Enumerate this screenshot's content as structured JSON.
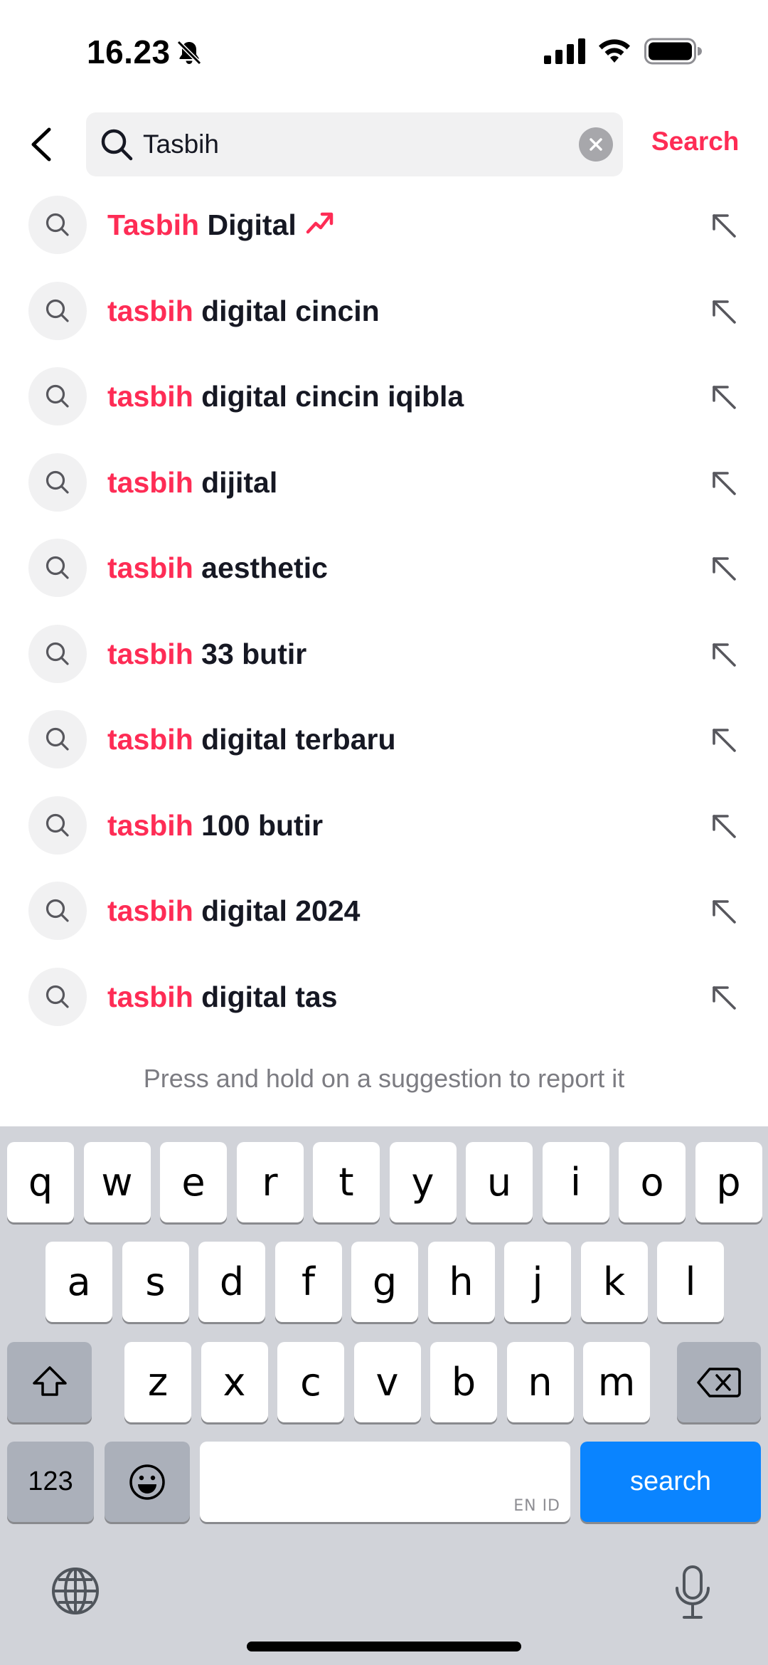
{
  "status_bar": {
    "time": "16.23",
    "icons": [
      "bell-muted-icon",
      "cellular-signal-icon",
      "wifi-icon",
      "battery-icon"
    ]
  },
  "header": {
    "back_icon": "chevron-left-icon",
    "search": {
      "value": "Tasbih",
      "icon": "search-icon",
      "clear_icon": "clear-icon"
    },
    "search_label": "Search"
  },
  "suggestions": [
    {
      "highlight": "Tasbih",
      "rest": " Digital",
      "trending": true
    },
    {
      "highlight": "tasbih",
      "rest": " digital cincin",
      "trending": false
    },
    {
      "highlight": "tasbih",
      "rest": " digital cincin iqibla",
      "trending": false
    },
    {
      "highlight": "tasbih",
      "rest": " dijital",
      "trending": false
    },
    {
      "highlight": "tasbih",
      "rest": " aesthetic",
      "trending": false
    },
    {
      "highlight": "tasbih",
      "rest": " 33 butir",
      "trending": false
    },
    {
      "highlight": "tasbih",
      "rest": " digital terbaru",
      "trending": false
    },
    {
      "highlight": "tasbih",
      "rest": " 100 butir",
      "trending": false
    },
    {
      "highlight": "tasbih",
      "rest": " digital 2024",
      "trending": false
    },
    {
      "highlight": "tasbih",
      "rest": " digital tas",
      "trending": false
    }
  ],
  "report_hint": "Press and hold on a suggestion to report it",
  "keyboard": {
    "row1": [
      "q",
      "w",
      "e",
      "r",
      "t",
      "y",
      "u",
      "i",
      "o",
      "p"
    ],
    "row2": [
      "a",
      "s",
      "d",
      "f",
      "g",
      "h",
      "j",
      "k",
      "l"
    ],
    "row3": [
      "z",
      "x",
      "c",
      "v",
      "b",
      "n",
      "m"
    ],
    "numbers_label": "123",
    "space_language": "EN ID",
    "action_label": "search"
  },
  "colors": {
    "accent": "#fe2c55",
    "keyboard_action": "#0a84ff",
    "keyboard_bg": "#d1d3d9"
  }
}
